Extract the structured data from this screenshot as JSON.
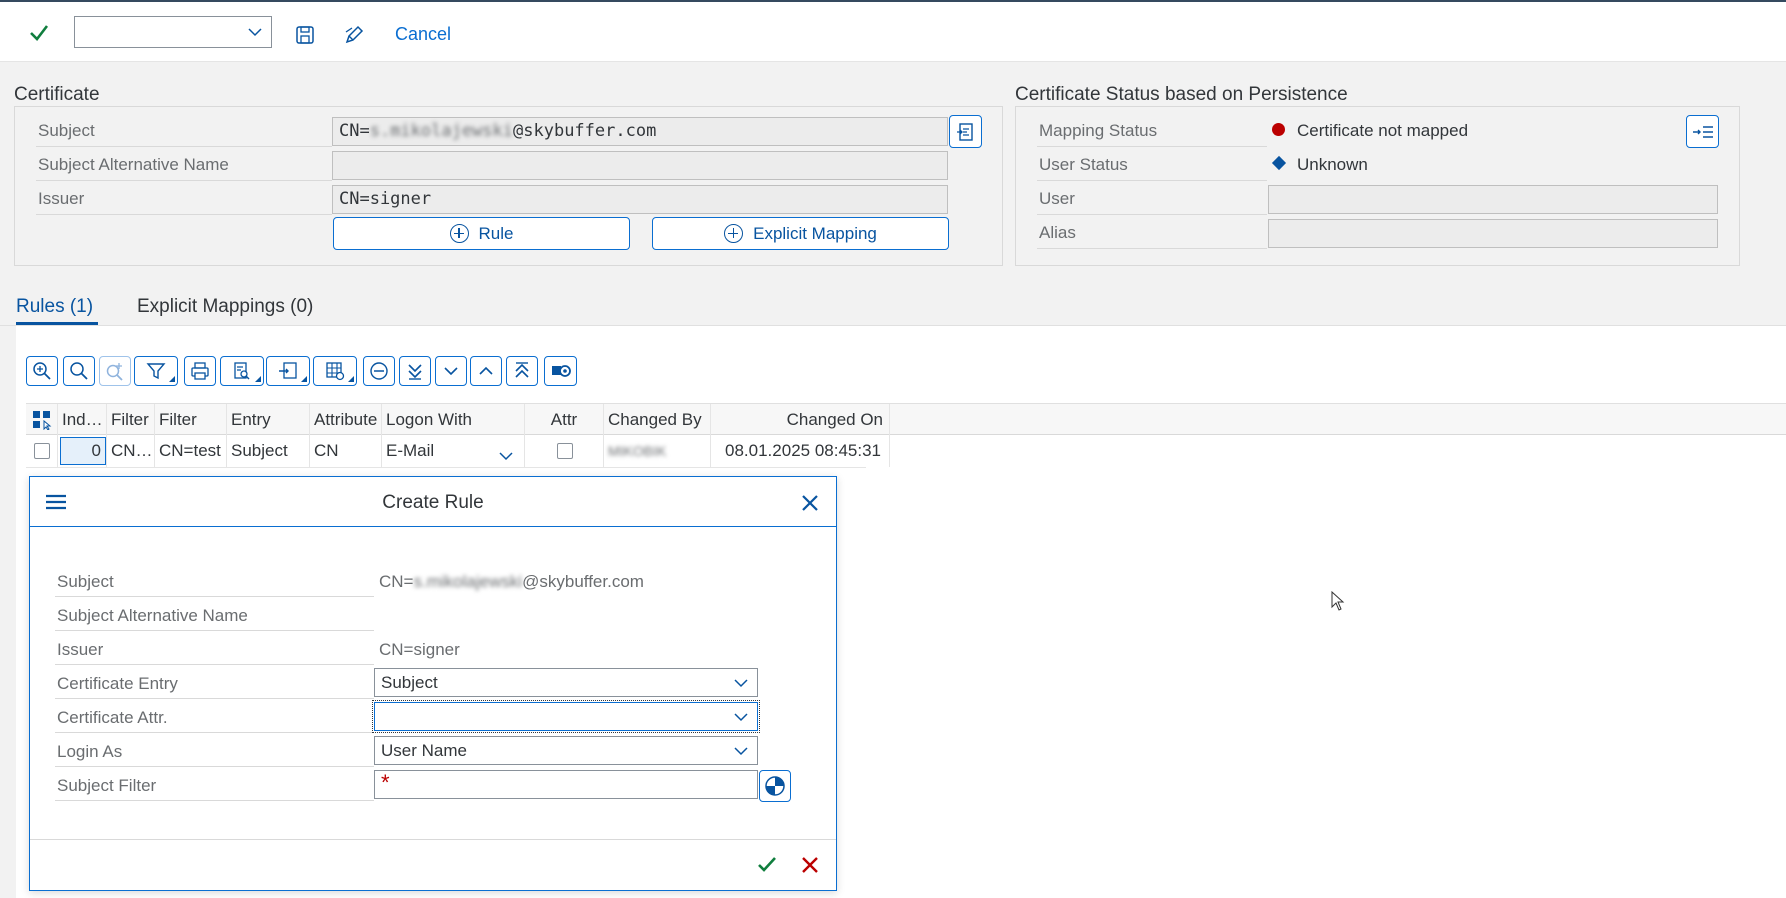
{
  "toolbar": {
    "command_field_value": "",
    "cancel_label": "Cancel"
  },
  "certificate": {
    "title": "Certificate",
    "subject_label": "Subject",
    "subject_prefix": "CN=",
    "subject_redacted": "s.mikolajewski",
    "subject_suffix": "@skybuffer.com",
    "san_label": "Subject Alternative Name",
    "san_value": "",
    "issuer_label": "Issuer",
    "issuer_value": "CN=signer",
    "rule_button": "Rule",
    "explicit_mapping_button": "Explicit Mapping"
  },
  "status": {
    "title": "Certificate Status based on Persistence",
    "mapping_status_label": "Mapping Status",
    "mapping_status_value": "Certificate not mapped",
    "user_status_label": "User Status",
    "user_status_value": "Unknown",
    "user_label": "User",
    "user_value": "",
    "alias_label": "Alias",
    "alias_value": "",
    "colors": {
      "error": "#bb0000",
      "info": "#0854a0"
    }
  },
  "tabs": [
    {
      "label": "Rules (1)",
      "active": true
    },
    {
      "label": "Explicit Mappings (0)",
      "active": false
    }
  ],
  "table": {
    "columns": [
      "Ind…",
      "Filter",
      "Filter",
      "Entry",
      "Attribute",
      "Logon With",
      "Attr",
      "Changed By",
      "Changed On"
    ],
    "rows": [
      {
        "index": "0",
        "filter1": "CN…",
        "filter2": "CN=test",
        "entry": "Subject",
        "attribute": "CN",
        "logon_with": "E-Mail",
        "attr_checked": false,
        "changed_by_redacted": "MIKOBIK",
        "changed_on": "08.01.2025 08:45:31"
      }
    ]
  },
  "dialog": {
    "title": "Create Rule",
    "subject_label": "Subject",
    "subject_prefix": "CN=",
    "subject_redacted": "s.mikolajewski",
    "subject_suffix": "@skybuffer.com",
    "san_label": "Subject Alternative Name",
    "issuer_label": "Issuer",
    "issuer_value": "CN=signer",
    "cert_entry_label": "Certificate Entry",
    "cert_entry_value": "Subject",
    "cert_attr_label": "Certificate Attr.",
    "cert_attr_value": "",
    "login_as_label": "Login As",
    "login_as_value": "User Name",
    "subject_filter_label": "Subject Filter",
    "required_marker": "*"
  }
}
